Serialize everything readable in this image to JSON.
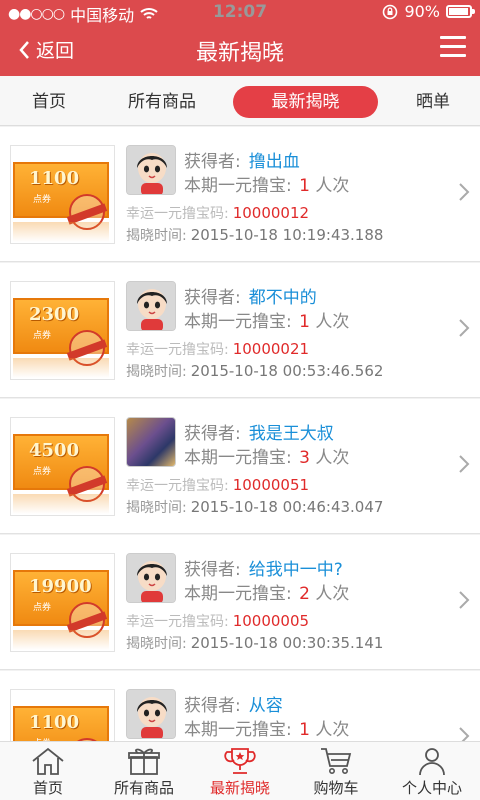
{
  "status": {
    "carrier": "中国移动",
    "time": "12:07",
    "battery": "90%"
  },
  "header": {
    "back_label": "返回",
    "title": "最新揭晓"
  },
  "tabs": [
    {
      "label": "首页"
    },
    {
      "label": "所有商品"
    },
    {
      "label": "最新揭晓",
      "active": true
    },
    {
      "label": "晒单"
    }
  ],
  "labels": {
    "winner": "获得者:",
    "times": "本期一元撸宝:",
    "times_unit": "人次",
    "code": "幸运一元撸宝码:",
    "time": "揭晓时间:"
  },
  "items": [
    {
      "coupon_amount": "1100",
      "winner": "撸出血",
      "times": "1",
      "lucky_code": "10000012",
      "reveal_time": "2015-10-18 10:19:43.188",
      "avatar": "cartoon-boy"
    },
    {
      "coupon_amount": "2300",
      "winner": "都不中的",
      "times": "1",
      "lucky_code": "10000021",
      "reveal_time": "2015-10-18 00:53:46.562",
      "avatar": "cartoon-boy"
    },
    {
      "coupon_amount": "4500",
      "winner": "我是王大叔",
      "times": "3",
      "lucky_code": "10000051",
      "reveal_time": "2015-10-18 00:46:43.047",
      "avatar": "game-character-photo"
    },
    {
      "coupon_amount": "19900",
      "winner": "给我中一中?",
      "times": "2",
      "lucky_code": "10000005",
      "reveal_time": "2015-10-18 00:30:35.141",
      "avatar": "cartoon-boy"
    },
    {
      "coupon_amount": "1100",
      "winner": "从容",
      "times": "1",
      "lucky_code": "",
      "reveal_time": "",
      "avatar": "cartoon-boy"
    }
  ],
  "coupon_unit": "点券",
  "bottom_nav": [
    {
      "label": "首页",
      "icon": "home-icon"
    },
    {
      "label": "所有商品",
      "icon": "gift-icon"
    },
    {
      "label": "最新揭晓",
      "icon": "trophy-icon",
      "active": true
    },
    {
      "label": "购物车",
      "icon": "cart-icon"
    },
    {
      "label": "个人中心",
      "icon": "user-icon"
    }
  ],
  "colors": {
    "header": "#dc4a4d",
    "accent": "#e02a2a",
    "link": "#1a8fd8"
  }
}
